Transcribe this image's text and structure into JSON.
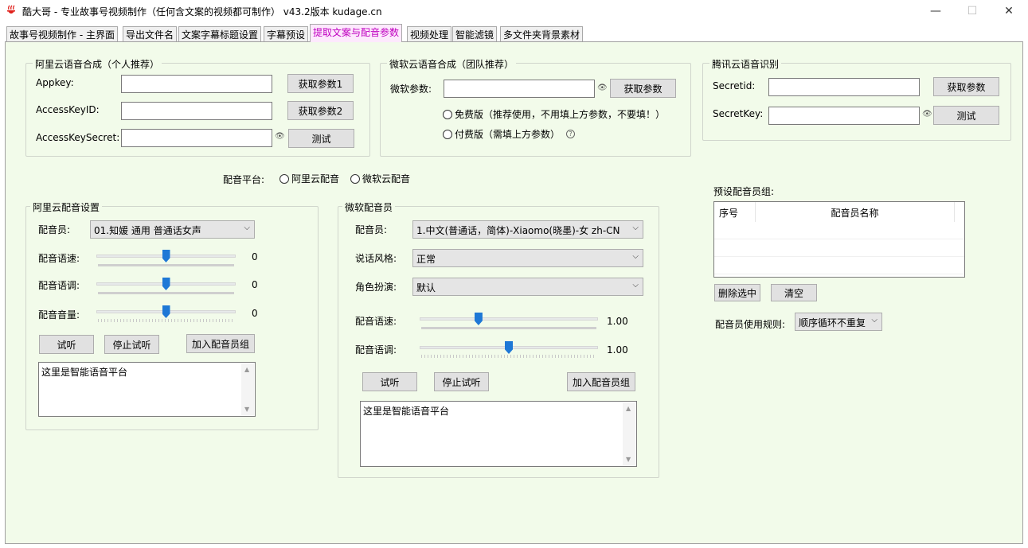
{
  "window": {
    "title": "酷大哥 -  专业故事号视频制作（任何含文案的视频都可制作）   v43.2版本    kudage.cn",
    "minimize": "—",
    "maximize": "☐",
    "close": "✕"
  },
  "tabs": [
    {
      "label": "故事号视频制作 - 主界面"
    },
    {
      "label": "导出文件名"
    },
    {
      "label": "文案字幕标题设置"
    },
    {
      "label": "字幕预设"
    },
    {
      "label": "提取文案与配音参数"
    },
    {
      "label": "视频处理"
    },
    {
      "label": "智能滤镜"
    },
    {
      "label": "多文件夹背景素材"
    }
  ],
  "aliyun_synth": {
    "title": "阿里云语音合成（个人推荐）",
    "appkey_label": "Appkey:",
    "accesskeyid_label": "AccessKeyID:",
    "accesskeysecret_label": "AccessKeySecret:",
    "get_param1": "获取参数1",
    "get_param2": "获取参数2",
    "test": "测试"
  },
  "ms_synth": {
    "title": "微软云语音合成（团队推荐）",
    "param_label": "微软参数:",
    "get_param": "获取参数",
    "free_option": "免费版（推荐使用，不用填上方参数，不要填！）",
    "paid_option": "付费版（需填上方参数）",
    "help": "?"
  },
  "tencent_asr": {
    "title": "腾讯云语音识别",
    "secretid_label": "Secretid:",
    "secretkey_label": "SecretKey:",
    "get_param": "获取参数",
    "test": "测试"
  },
  "platform": {
    "label": "配音平台:",
    "aliyun": "阿里云配音",
    "microsoft": "微软云配音"
  },
  "aliyun_voice": {
    "title": "阿里云配音设置",
    "voice_label": "配音员:",
    "voice_value": "01.知媛 通用 普通话女声",
    "speed_label": "配音语速:",
    "pitch_label": "配音语调:",
    "volume_label": "配音音量:",
    "speed_value": "0",
    "pitch_value": "0",
    "volume_value": "0",
    "speed_level": 0.5,
    "pitch_level": 0.5,
    "volume_level": 0.5,
    "listen": "试听",
    "stop": "停止试听",
    "add_group": "加入配音员组",
    "text": "这里是智能语音平台"
  },
  "ms_voice": {
    "title": "微软配音员",
    "voice_label": "配音员:",
    "voice_value": "1.中文(普通话，简体)-Xiaomo(晓墨)-女 zh-CN",
    "style_label": "说话风格:",
    "style_value": "正常",
    "role_label": "角色扮演:",
    "role_value": "默认",
    "speed_label": "配音语速:",
    "pitch_label": "配音语调:",
    "speed_value": "1.00",
    "pitch_value": "1.00",
    "speed_level": 0.33,
    "pitch_level": 0.5,
    "listen": "试听",
    "stop": "停止试听",
    "add_group": "加入配音员组",
    "text": "这里是智能语音平台"
  },
  "preset_group": {
    "label": "预设配音员组:",
    "col_no": "序号",
    "col_name": "配音员名称",
    "delete": "删除选中",
    "clear": "清空",
    "rule_label": "配音员使用规则:",
    "rule_value": "顺序循环不重复"
  }
}
